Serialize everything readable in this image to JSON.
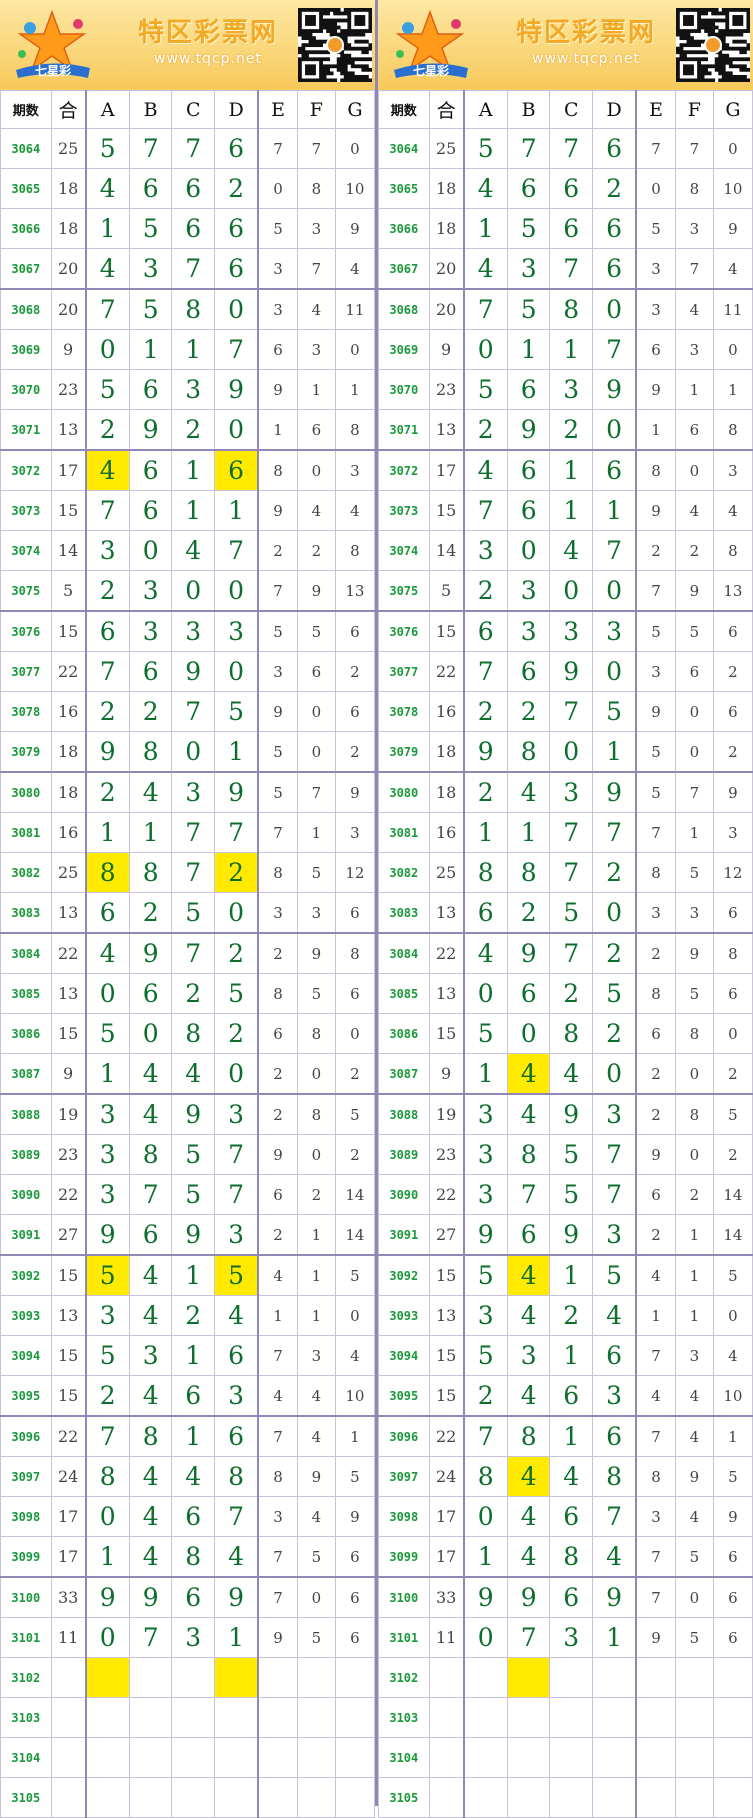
{
  "banner": {
    "title": "特区彩票网",
    "url": "www.tqcp.net",
    "logo_text": "七星彩",
    "colors": {
      "title": "#f3a826",
      "background": "#f7c95a"
    }
  },
  "headers": [
    "期数",
    "合",
    "A",
    "B",
    "C",
    "D",
    "E",
    "F",
    "G"
  ],
  "rows": [
    {
      "issue": "3064",
      "sum": "25",
      "a": "5",
      "b": "7",
      "c": "7",
      "d": "6",
      "e": "7",
      "f": "7",
      "g": "0"
    },
    {
      "issue": "3065",
      "sum": "18",
      "a": "4",
      "b": "6",
      "c": "6",
      "d": "2",
      "e": "0",
      "f": "8",
      "g": "10"
    },
    {
      "issue": "3066",
      "sum": "18",
      "a": "1",
      "b": "5",
      "c": "6",
      "d": "6",
      "e": "5",
      "f": "3",
      "g": "9"
    },
    {
      "issue": "3067",
      "sum": "20",
      "a": "4",
      "b": "3",
      "c": "7",
      "d": "6",
      "e": "3",
      "f": "7",
      "g": "4"
    },
    {
      "issue": "3068",
      "sum": "20",
      "a": "7",
      "b": "5",
      "c": "8",
      "d": "0",
      "e": "3",
      "f": "4",
      "g": "11"
    },
    {
      "issue": "3069",
      "sum": "9",
      "a": "0",
      "b": "1",
      "c": "1",
      "d": "7",
      "e": "6",
      "f": "3",
      "g": "0"
    },
    {
      "issue": "3070",
      "sum": "23",
      "a": "5",
      "b": "6",
      "c": "3",
      "d": "9",
      "e": "9",
      "f": "1",
      "g": "1"
    },
    {
      "issue": "3071",
      "sum": "13",
      "a": "2",
      "b": "9",
      "c": "2",
      "d": "0",
      "e": "1",
      "f": "6",
      "g": "8"
    },
    {
      "issue": "3072",
      "sum": "17",
      "a": "4",
      "b": "6",
      "c": "1",
      "d": "6",
      "e": "8",
      "f": "0",
      "g": "3"
    },
    {
      "issue": "3073",
      "sum": "15",
      "a": "7",
      "b": "6",
      "c": "1",
      "d": "1",
      "e": "9",
      "f": "4",
      "g": "4"
    },
    {
      "issue": "3074",
      "sum": "14",
      "a": "3",
      "b": "0",
      "c": "4",
      "d": "7",
      "e": "2",
      "f": "2",
      "g": "8"
    },
    {
      "issue": "3075",
      "sum": "5",
      "a": "2",
      "b": "3",
      "c": "0",
      "d": "0",
      "e": "7",
      "f": "9",
      "g": "13"
    },
    {
      "issue": "3076",
      "sum": "15",
      "a": "6",
      "b": "3",
      "c": "3",
      "d": "3",
      "e": "5",
      "f": "5",
      "g": "6"
    },
    {
      "issue": "3077",
      "sum": "22",
      "a": "7",
      "b": "6",
      "c": "9",
      "d": "0",
      "e": "3",
      "f": "6",
      "g": "2"
    },
    {
      "issue": "3078",
      "sum": "16",
      "a": "2",
      "b": "2",
      "c": "7",
      "d": "5",
      "e": "9",
      "f": "0",
      "g": "6"
    },
    {
      "issue": "3079",
      "sum": "18",
      "a": "9",
      "b": "8",
      "c": "0",
      "d": "1",
      "e": "5",
      "f": "0",
      "g": "2"
    },
    {
      "issue": "3080",
      "sum": "18",
      "a": "2",
      "b": "4",
      "c": "3",
      "d": "9",
      "e": "5",
      "f": "7",
      "g": "9"
    },
    {
      "issue": "3081",
      "sum": "16",
      "a": "1",
      "b": "1",
      "c": "7",
      "d": "7",
      "e": "7",
      "f": "1",
      "g": "3"
    },
    {
      "issue": "3082",
      "sum": "25",
      "a": "8",
      "b": "8",
      "c": "7",
      "d": "2",
      "e": "8",
      "f": "5",
      "g": "12"
    },
    {
      "issue": "3083",
      "sum": "13",
      "a": "6",
      "b": "2",
      "c": "5",
      "d": "0",
      "e": "3",
      "f": "3",
      "g": "6"
    },
    {
      "issue": "3084",
      "sum": "22",
      "a": "4",
      "b": "9",
      "c": "7",
      "d": "2",
      "e": "2",
      "f": "9",
      "g": "8"
    },
    {
      "issue": "3085",
      "sum": "13",
      "a": "0",
      "b": "6",
      "c": "2",
      "d": "5",
      "e": "8",
      "f": "5",
      "g": "6"
    },
    {
      "issue": "3086",
      "sum": "15",
      "a": "5",
      "b": "0",
      "c": "8",
      "d": "2",
      "e": "6",
      "f": "8",
      "g": "0"
    },
    {
      "issue": "3087",
      "sum": "9",
      "a": "1",
      "b": "4",
      "c": "4",
      "d": "0",
      "e": "2",
      "f": "0",
      "g": "2"
    },
    {
      "issue": "3088",
      "sum": "19",
      "a": "3",
      "b": "4",
      "c": "9",
      "d": "3",
      "e": "2",
      "f": "8",
      "g": "5"
    },
    {
      "issue": "3089",
      "sum": "23",
      "a": "3",
      "b": "8",
      "c": "5",
      "d": "7",
      "e": "9",
      "f": "0",
      "g": "2"
    },
    {
      "issue": "3090",
      "sum": "22",
      "a": "3",
      "b": "7",
      "c": "5",
      "d": "7",
      "e": "6",
      "f": "2",
      "g": "14"
    },
    {
      "issue": "3091",
      "sum": "27",
      "a": "9",
      "b": "6",
      "c": "9",
      "d": "3",
      "e": "2",
      "f": "1",
      "g": "14"
    },
    {
      "issue": "3092",
      "sum": "15",
      "a": "5",
      "b": "4",
      "c": "1",
      "d": "5",
      "e": "4",
      "f": "1",
      "g": "5"
    },
    {
      "issue": "3093",
      "sum": "13",
      "a": "3",
      "b": "4",
      "c": "2",
      "d": "4",
      "e": "1",
      "f": "1",
      "g": "0"
    },
    {
      "issue": "3094",
      "sum": "15",
      "a": "5",
      "b": "3",
      "c": "1",
      "d": "6",
      "e": "7",
      "f": "3",
      "g": "4"
    },
    {
      "issue": "3095",
      "sum": "15",
      "a": "2",
      "b": "4",
      "c": "6",
      "d": "3",
      "e": "4",
      "f": "4",
      "g": "10"
    },
    {
      "issue": "3096",
      "sum": "22",
      "a": "7",
      "b": "8",
      "c": "1",
      "d": "6",
      "e": "7",
      "f": "4",
      "g": "1"
    },
    {
      "issue": "3097",
      "sum": "24",
      "a": "8",
      "b": "4",
      "c": "4",
      "d": "8",
      "e": "8",
      "f": "9",
      "g": "5"
    },
    {
      "issue": "3098",
      "sum": "17",
      "a": "0",
      "b": "4",
      "c": "6",
      "d": "7",
      "e": "3",
      "f": "4",
      "g": "9"
    },
    {
      "issue": "3099",
      "sum": "17",
      "a": "1",
      "b": "4",
      "c": "8",
      "d": "4",
      "e": "7",
      "f": "5",
      "g": "6"
    },
    {
      "issue": "3100",
      "sum": "33",
      "a": "9",
      "b": "9",
      "c": "6",
      "d": "9",
      "e": "7",
      "f": "0",
      "g": "6"
    },
    {
      "issue": "3101",
      "sum": "11",
      "a": "0",
      "b": "7",
      "c": "3",
      "d": "1",
      "e": "9",
      "f": "5",
      "g": "6"
    },
    {
      "issue": "3102",
      "sum": "",
      "a": "",
      "b": "",
      "c": "",
      "d": "",
      "e": "",
      "f": "",
      "g": ""
    },
    {
      "issue": "3103",
      "sum": "",
      "a": "",
      "b": "",
      "c": "",
      "d": "",
      "e": "",
      "f": "",
      "g": ""
    },
    {
      "issue": "3104",
      "sum": "",
      "a": "",
      "b": "",
      "c": "",
      "d": "",
      "e": "",
      "f": "",
      "g": ""
    },
    {
      "issue": "3105",
      "sum": "",
      "a": "",
      "b": "",
      "c": "",
      "d": "",
      "e": "",
      "f": "",
      "g": ""
    }
  ],
  "panels": [
    {
      "highlights": {
        "3072": [
          "a",
          "d"
        ],
        "3082": [
          "a",
          "d"
        ],
        "3092": [
          "a",
          "d"
        ],
        "3102": [
          "a",
          "d"
        ]
      }
    },
    {
      "highlights": {
        "3087": [
          "b"
        ],
        "3092": [
          "b"
        ],
        "3097": [
          "b"
        ],
        "3102": [
          "b"
        ]
      }
    }
  ],
  "group_size": 4,
  "highlight_color": "#ffea00"
}
